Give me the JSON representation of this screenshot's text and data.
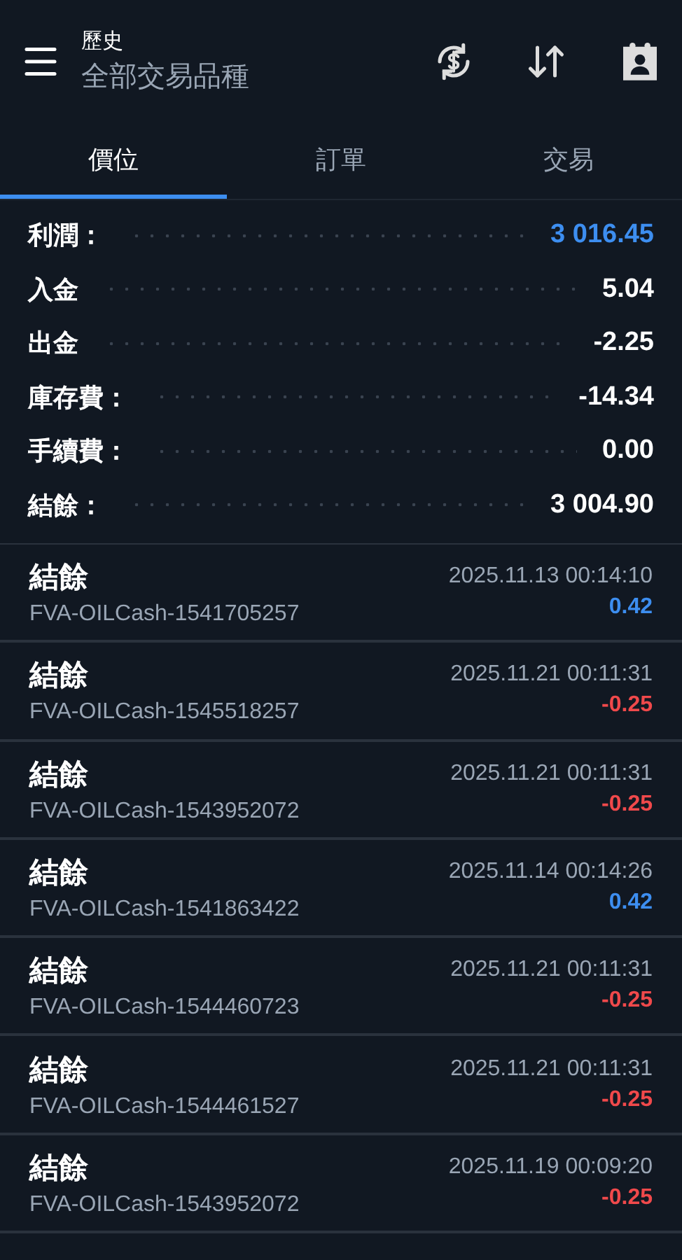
{
  "header": {
    "title": "歷史",
    "subtitle": "全部交易品種"
  },
  "tabs": [
    {
      "label": "價位",
      "selected": true
    },
    {
      "label": "訂單",
      "selected": false
    },
    {
      "label": "交易",
      "selected": false
    }
  ],
  "summary": [
    {
      "label": "利潤：",
      "value": "3 016.45",
      "color": "#3d8ef0"
    },
    {
      "label": "入金",
      "value": "5.04",
      "color": "#ffffff"
    },
    {
      "label": "出金",
      "value": "-2.25",
      "color": "#ffffff"
    },
    {
      "label": "庫存費：",
      "value": "-14.34",
      "color": "#ffffff"
    },
    {
      "label": "手續費：",
      "value": "0.00",
      "color": "#ffffff"
    },
    {
      "label": "結餘：",
      "value": "3 004.90",
      "color": "#ffffff"
    }
  ],
  "entries": [
    {
      "type": "結餘",
      "symbol": "FVA-OILCash-1541705257",
      "time": "2025.11.13 00:14:10",
      "amount": "0.42",
      "color": "#3d8ef0"
    },
    {
      "type": "結餘",
      "symbol": "FVA-OILCash-1545518257",
      "time": "2025.11.21 00:11:31",
      "amount": "-0.25",
      "color": "#f0494b"
    },
    {
      "type": "結餘",
      "symbol": "FVA-OILCash-1543952072",
      "time": "2025.11.21 00:11:31",
      "amount": "-0.25",
      "color": "#f0494b"
    },
    {
      "type": "結餘",
      "symbol": "FVA-OILCash-1541863422",
      "time": "2025.11.14 00:14:26",
      "amount": "0.42",
      "color": "#3d8ef0"
    },
    {
      "type": "結餘",
      "symbol": "FVA-OILCash-1544460723",
      "time": "2025.11.21 00:11:31",
      "amount": "-0.25",
      "color": "#f0494b"
    },
    {
      "type": "結餘",
      "symbol": "FVA-OILCash-1544461527",
      "time": "2025.11.21 00:11:31",
      "amount": "-0.25",
      "color": "#f0494b"
    },
    {
      "type": "結餘",
      "symbol": "FVA-OILCash-1543952072",
      "time": "2025.11.19 00:09:20",
      "amount": "-0.25",
      "color": "#f0494b"
    }
  ]
}
